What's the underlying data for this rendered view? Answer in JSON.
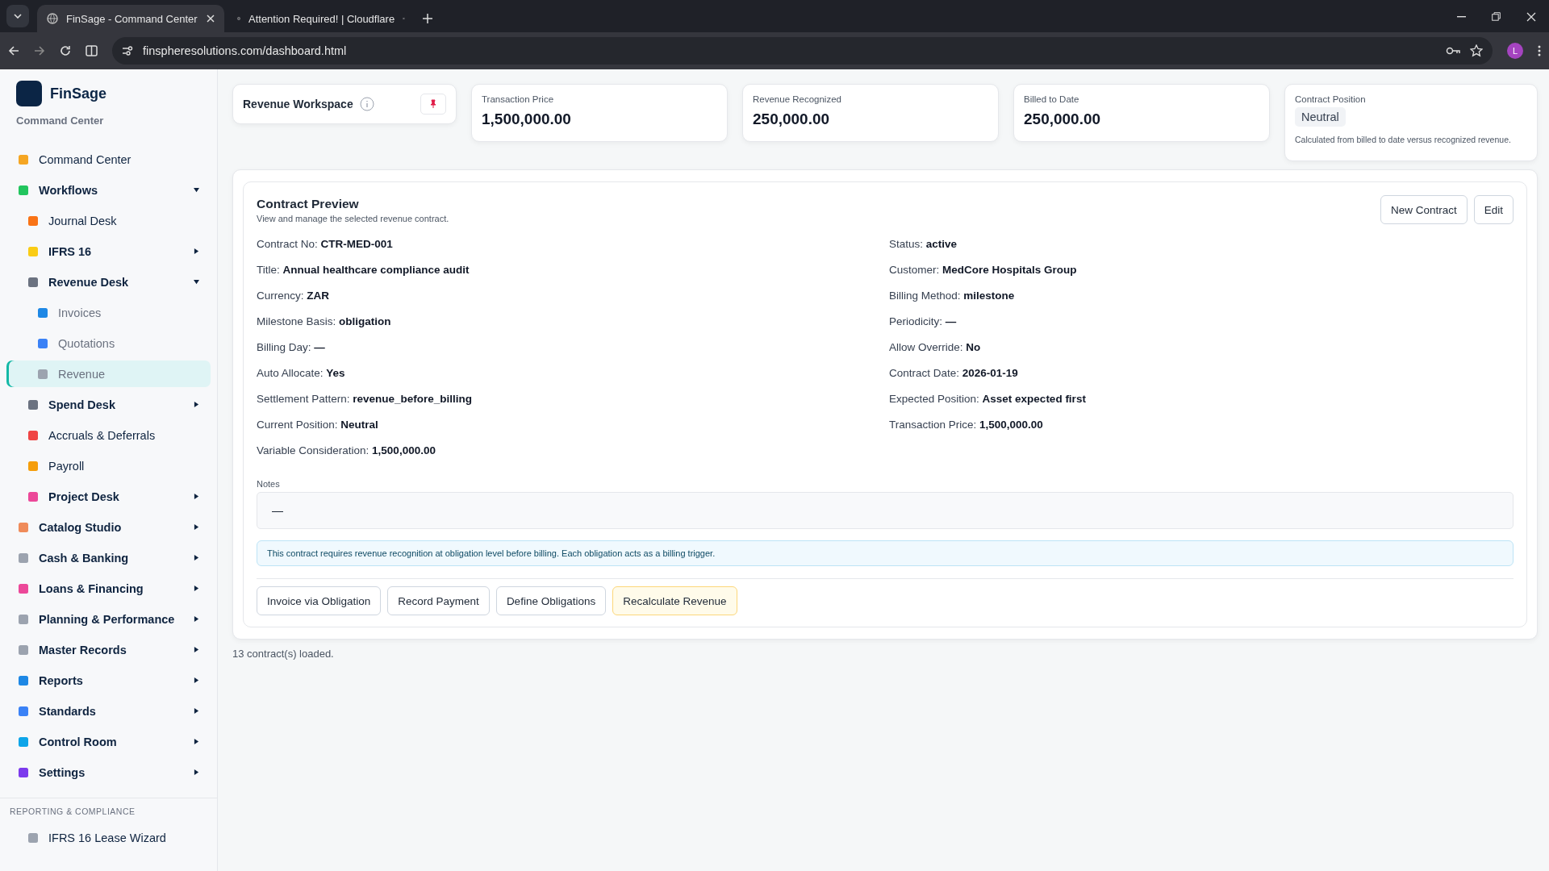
{
  "browser": {
    "tabs": [
      {
        "title": "FinSage - Command Center",
        "selected": true
      },
      {
        "title": "Attention Required! | Cloudflare",
        "selected": false
      }
    ],
    "url": "finspheresolutions.com/dashboard.html",
    "profile": "L"
  },
  "sidebar": {
    "brand": "FinSage",
    "subtitle": "Command Center",
    "items": [
      {
        "label": "Command Center",
        "selected": false
      },
      {
        "label": "Workflows",
        "selected": false,
        "expanded": true,
        "children": [
          {
            "label": "Journal Desk",
            "selected": false
          },
          {
            "label": "IFRS 16",
            "selected": false,
            "expanded": false
          },
          {
            "label": "Revenue Desk",
            "selected": false,
            "expanded": true,
            "children": [
              {
                "label": "Invoices",
                "selected": false
              },
              {
                "label": "Quotations",
                "selected": false
              },
              {
                "label": "Revenue",
                "selected": true
              }
            ]
          },
          {
            "label": "Spend Desk",
            "selected": false,
            "expanded": false
          },
          {
            "label": "Accruals & Deferrals",
            "selected": false
          },
          {
            "label": "Payroll",
            "selected": false
          },
          {
            "label": "Project Desk",
            "selected": false,
            "expanded": false
          }
        ]
      },
      {
        "label": "Catalog Studio",
        "selected": false,
        "expanded": false
      },
      {
        "label": "Cash & Banking",
        "selected": false,
        "expanded": false
      },
      {
        "label": "Loans & Financing",
        "selected": false,
        "expanded": false
      },
      {
        "label": "Planning & Performance",
        "selected": false,
        "expanded": false
      },
      {
        "label": "Master Records",
        "selected": false,
        "expanded": false
      },
      {
        "label": "Reports",
        "selected": false,
        "expanded": false
      },
      {
        "label": "Standards",
        "selected": false,
        "expanded": false
      },
      {
        "label": "Control Room",
        "selected": false,
        "expanded": false
      },
      {
        "label": "Settings",
        "selected": false,
        "expanded": false
      }
    ],
    "section": {
      "heading": "REPORTING & COMPLIANCE",
      "items": [
        {
          "label": "IFRS 16 Lease Wizard",
          "selected": false
        }
      ]
    }
  },
  "workspace": {
    "title": "Revenue Workspace"
  },
  "stats": [
    {
      "label": "Transaction Price",
      "value": "1,500,000.00"
    },
    {
      "label": "Revenue Recognized",
      "value": "250,000.00"
    },
    {
      "label": "Billed to Date",
      "value": "250,000.00"
    }
  ],
  "position": {
    "label": "Contract Position",
    "value": "Neutral",
    "note": "Calculated from billed to date versus recognized revenue."
  },
  "preview": {
    "title": "Contract Preview",
    "subtitle": "View and manage the selected revenue contract.",
    "actions": [
      "New Contract",
      "Edit"
    ],
    "field_columns": [
      [
        "Contract No: **CTR-MED-001**",
        "Title: **Annual healthcare compliance audit**",
        "Currency: **ZAR**",
        "Milestone Basis: **obligation**",
        "Billing Day: **—**",
        "Auto Allocate: **Yes**",
        "Settlement Pattern: **revenue_before_billing**",
        "Current Position: **Neutral**",
        "Variable Consideration: **1,500,000.00**"
      ],
      [
        "Status: **active**",
        "Customer: **MedCore Hospitals Group**",
        "Billing Method: **milestone**",
        "Periodicity: **—**",
        "Allow Override: **No**",
        "Contract Date: **2026-01-19**",
        "Expected Position: **Asset expected first**",
        "Transaction Price: **1,500,000.00**"
      ]
    ],
    "notes_label": "Notes",
    "notes": "—",
    "info": "This contract requires revenue recognition at obligation level before billing. Each obligation acts as a billing trigger.",
    "buttons": [
      {
        "label": "Invoice via Obligation",
        "kind": "plain"
      },
      {
        "label": "Record Payment",
        "kind": "plain"
      },
      {
        "label": "Define Obligations",
        "kind": "plain"
      },
      {
        "label": "Recalculate Revenue",
        "kind": "warning"
      }
    ]
  },
  "footer": "13 contract(s) loaded."
}
